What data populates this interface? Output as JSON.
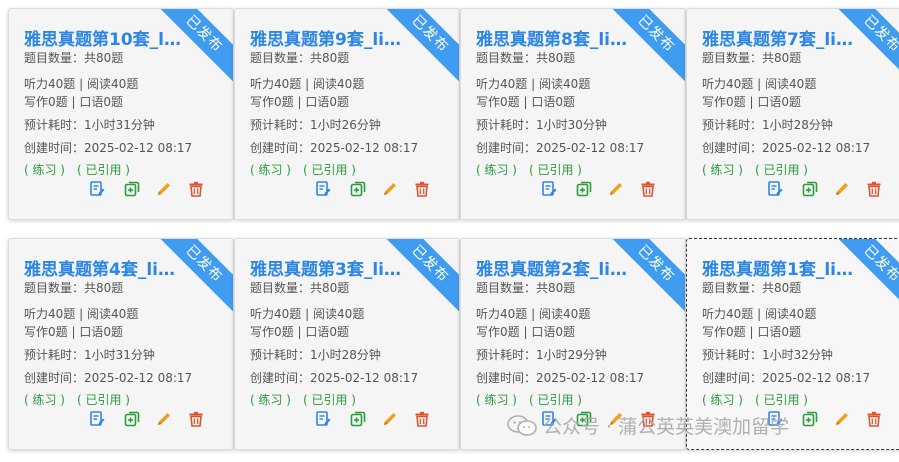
{
  "ribbon_label": "已发布",
  "tags": {
    "practice": "( 练习 )",
    "cited": "( 已引用 )"
  },
  "labels": {
    "count_prefix": "题目数量：共",
    "count_suffix": "题",
    "listen_prefix": "听力",
    "read_prefix": "阅读",
    "write_prefix": "写作",
    "speak_prefix": "口语",
    "unit_q": "题",
    "sep": "|",
    "time_prefix": "预计耗时：",
    "created_prefix": "创建时间："
  },
  "cards": [
    {
      "title": "雅思真题第10套_list...",
      "count": "80",
      "listen": "40",
      "read": "40",
      "write": "0",
      "speak": "0",
      "time": "1小时31分钟",
      "created": "2025-02-12 08:17"
    },
    {
      "title": "雅思真题第9套_list...",
      "count": "80",
      "listen": "40",
      "read": "40",
      "write": "0",
      "speak": "0",
      "time": "1小时26分钟",
      "created": "2025-02-12 08:17"
    },
    {
      "title": "雅思真题第8套_list...",
      "count": "80",
      "listen": "40",
      "read": "40",
      "write": "0",
      "speak": "0",
      "time": "1小时30分钟",
      "created": "2025-02-12 08:17"
    },
    {
      "title": "雅思真题第7套_list...",
      "count": "80",
      "listen": "40",
      "read": "40",
      "write": "0",
      "speak": "0",
      "time": "1小时28分钟",
      "created": "2025-02-12 08:17"
    },
    {
      "title": "雅思真题第4套_list...",
      "count": "80",
      "listen": "40",
      "read": "40",
      "write": "0",
      "speak": "0",
      "time": "1小时31分钟",
      "created": "2025-02-12 08:17"
    },
    {
      "title": "雅思真题第3套_list...",
      "count": "80",
      "listen": "40",
      "read": "40",
      "write": "0",
      "speak": "0",
      "time": "1小时28分钟",
      "created": "2025-02-12 08:17"
    },
    {
      "title": "雅思真题第2套_list...",
      "count": "80",
      "listen": "40",
      "read": "40",
      "write": "0",
      "speak": "0",
      "time": "1小时29分钟",
      "created": "2025-02-12 08:17"
    },
    {
      "title": "雅思真题第1套_list...",
      "count": "80",
      "listen": "40",
      "read": "40",
      "write": "0",
      "speak": "0",
      "time": "1小时32分钟",
      "created": "2025-02-12 08:17"
    }
  ],
  "colors": {
    "title": "#2c86e8",
    "ribbon": "#3f9cf0",
    "tag": "#2a9d3b",
    "edit_icon": "#2f86e6",
    "copy_icon": "#2a9d3b",
    "pencil_icon": "#f0a020",
    "delete_icon": "#e0542e"
  },
  "icons": [
    "edit-doc-icon",
    "copy-add-icon",
    "pencil-icon",
    "trash-icon"
  ],
  "watermark": "公众号 · 蒲公英英美澳加留学"
}
